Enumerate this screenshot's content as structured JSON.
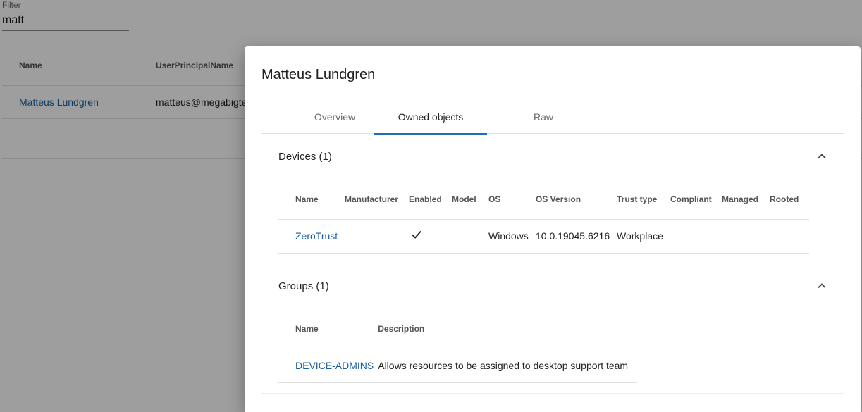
{
  "filter": {
    "label": "Filter",
    "value": "matt"
  },
  "users_table": {
    "columns": [
      "Name",
      "UserPrincipalName"
    ],
    "rows": [
      {
        "name": "Matteus Lundgren",
        "upn": "matteus@megabigte"
      }
    ]
  },
  "dialog": {
    "title": "Matteus Lundgren",
    "tabs": [
      "Overview",
      "Owned objects",
      "Raw"
    ],
    "active_tab": "Owned objects",
    "devices": {
      "title": "Devices (1)",
      "columns": [
        "Name",
        "Manufacturer",
        "Enabled",
        "Model",
        "OS",
        "OS Version",
        "Trust type",
        "Compliant",
        "Managed",
        "Rooted"
      ],
      "rows": [
        {
          "name": "ZeroTrust",
          "manufacturer": "",
          "enabled": true,
          "model": "",
          "os": "Windows",
          "os_version": "10.0.19045.6216",
          "trust_type": "Workplace",
          "compliant": "",
          "managed": "",
          "rooted": ""
        }
      ]
    },
    "groups": {
      "title": "Groups (1)",
      "columns": [
        "Name",
        "Description"
      ],
      "rows": [
        {
          "name": "DEVICE-ADMINS",
          "description": "Allows resources to be assigned to desktop support team"
        }
      ]
    }
  },
  "colors": {
    "link": "#1b5fa0",
    "tab_indicator": "#1f6fb5",
    "backdrop": "rgba(0,0,0,0.38)"
  },
  "icons": {
    "expand": "chevron-up-icon",
    "enabled": "check-icon"
  }
}
